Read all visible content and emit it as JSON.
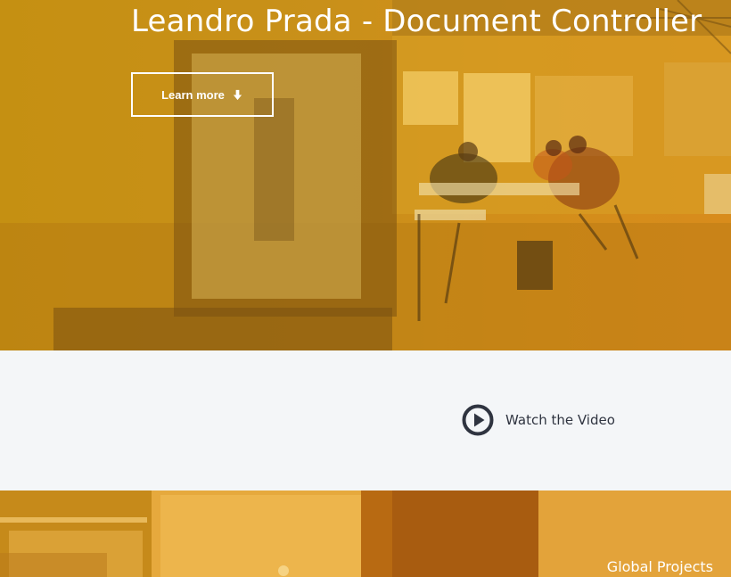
{
  "hero": {
    "title": "Leandro Prada - Document Controller",
    "learn_more_label": "Learn more",
    "arrow_icon": "arrow-down-icon"
  },
  "video": {
    "label": "Watch the Video",
    "icon": "play-circle-icon"
  },
  "bottom": {
    "panel_label": "Global Projects"
  },
  "colors": {
    "hero_overlay": "#c9901a",
    "panel": "#e3a33a",
    "band_background": "#f4f6f8",
    "text_dark": "#2f3440"
  }
}
